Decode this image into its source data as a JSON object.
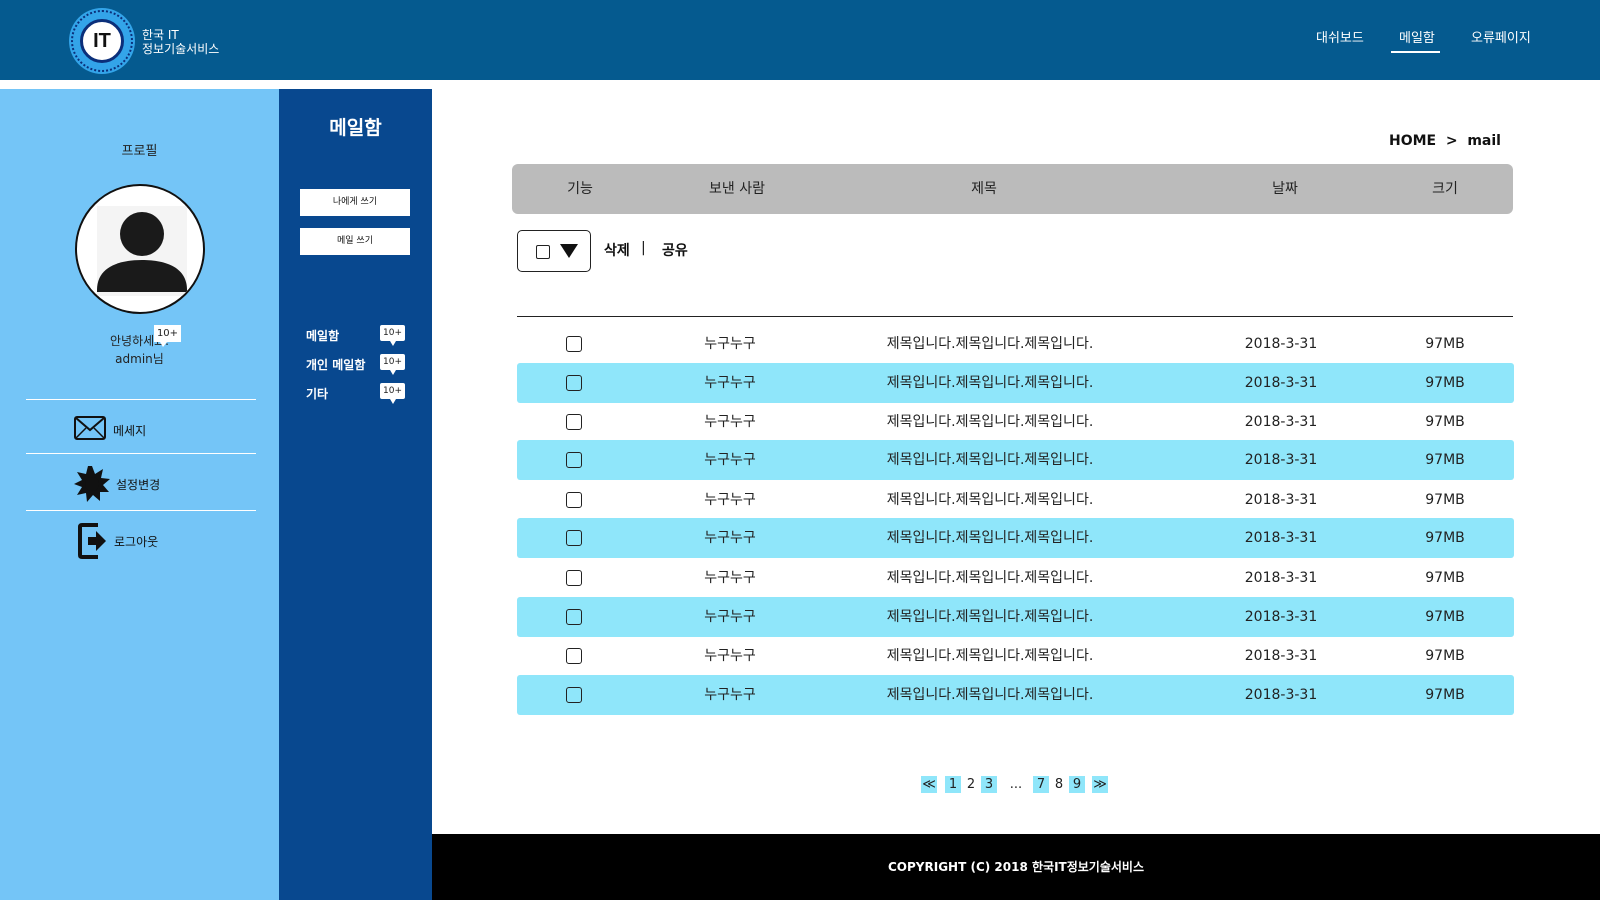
{
  "header": {
    "logo_text": "IT",
    "brand_line1": "한국 IT",
    "brand_line2": "정보기술서비스",
    "nav": [
      "대쉬보드",
      "메일함",
      "오류페이지"
    ],
    "active_nav": "메일함"
  },
  "profile": {
    "heading": "프로필",
    "greeting": "안녕하세요.",
    "username": "admin님",
    "menu": [
      {
        "label": "메세지",
        "icon": "envelope-icon",
        "badge": "10+"
      },
      {
        "label": "설정변경",
        "icon": "gear-icon"
      },
      {
        "label": "로그아웃",
        "icon": "logout-icon"
      }
    ]
  },
  "mail_sidebar": {
    "title": "메일함",
    "buttons": [
      "나에게 쓰기",
      "메일 쓰기"
    ],
    "folders": [
      {
        "label": "메일함",
        "badge": "10+"
      },
      {
        "label": "개인 메일함",
        "badge": "10+"
      },
      {
        "label": "기타",
        "badge": "10+"
      }
    ]
  },
  "breadcrumb": "HOME  >  mail",
  "table": {
    "columns": [
      "기능",
      "보낸 사람",
      "제목",
      "날짜",
      "크기"
    ],
    "actions": {
      "delete": "삭제",
      "separator": "|",
      "share": "공유"
    },
    "rows": [
      {
        "sender": "누구누구",
        "subject": "제목입니다.제목입니다.제목입니다.",
        "date": "2018-3-31",
        "size": "97MB"
      },
      {
        "sender": "누구누구",
        "subject": "제목입니다.제목입니다.제목입니다.",
        "date": "2018-3-31",
        "size": "97MB"
      },
      {
        "sender": "누구누구",
        "subject": "제목입니다.제목입니다.제목입니다.",
        "date": "2018-3-31",
        "size": "97MB"
      },
      {
        "sender": "누구누구",
        "subject": "제목입니다.제목입니다.제목입니다.",
        "date": "2018-3-31",
        "size": "97MB"
      },
      {
        "sender": "누구누구",
        "subject": "제목입니다.제목입니다.제목입니다.",
        "date": "2018-3-31",
        "size": "97MB"
      },
      {
        "sender": "누구누구",
        "subject": "제목입니다.제목입니다.제목입니다.",
        "date": "2018-3-31",
        "size": "97MB"
      },
      {
        "sender": "누구누구",
        "subject": "제목입니다.제목입니다.제목입니다.",
        "date": "2018-3-31",
        "size": "97MB"
      },
      {
        "sender": "누구누구",
        "subject": "제목입니다.제목입니다.제목입니다.",
        "date": "2018-3-31",
        "size": "97MB"
      },
      {
        "sender": "누구누구",
        "subject": "제목입니다.제목입니다.제목입니다.",
        "date": "2018-3-31",
        "size": "97MB"
      },
      {
        "sender": "누구누구",
        "subject": "제목입니다.제목입니다.제목입니다.",
        "date": "2018-3-31",
        "size": "97MB"
      }
    ]
  },
  "pagination": {
    "prev": "≪",
    "pages": [
      "1",
      "2",
      "3",
      "...",
      "7",
      "8",
      "9"
    ],
    "next": "≫"
  },
  "footer": "COPYRIGHT (C) 2018 한국IT정보기술서비스",
  "colors": {
    "header_bg": "#055a8f",
    "profile_bg": "#74c5f7",
    "mail_sidebar_bg": "#08488f",
    "row_stripe": "#8fe6fa",
    "table_header_bg": "#bbbbbb",
    "footer_bg": "#000000"
  }
}
